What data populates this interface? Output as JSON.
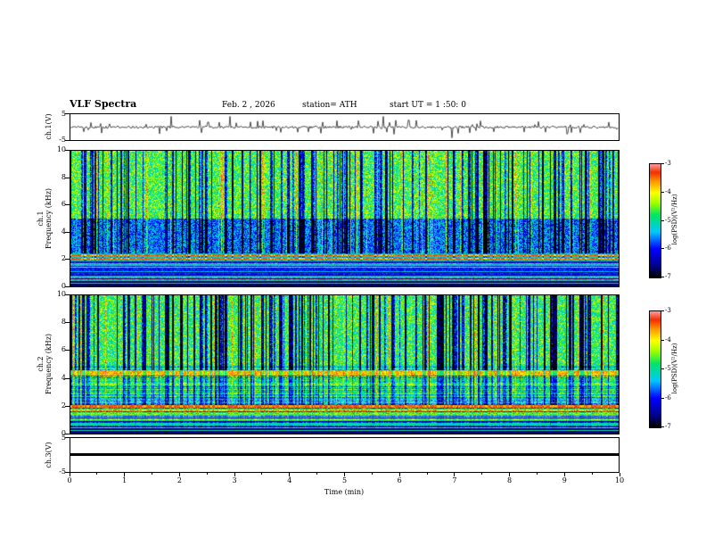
{
  "header": {
    "title": "VLF Spectra",
    "date": "Feb. 2 , 2026",
    "station": "station= ATH",
    "start_ut": "start UT =  1 :50: 0"
  },
  "x_axis": {
    "label": "Time (min)",
    "ticks": [
      "0",
      "1",
      "2",
      "3",
      "4",
      "5",
      "6",
      "7",
      "8",
      "9",
      "10"
    ]
  },
  "panels": {
    "wave1": {
      "ylabel": "ch.1(V)",
      "ytick_top": "5",
      "ytick_bottom": "-5"
    },
    "spec1": {
      "ylabel_line1": "ch.1",
      "ylabel_line2": "Frequency (kHz)",
      "yticks": [
        "10",
        "8",
        "6",
        "4",
        "2",
        "0"
      ]
    },
    "spec2": {
      "ylabel_line1": "ch.2",
      "ylabel_line2": "Frequency (kHz)",
      "yticks": [
        "10",
        "8",
        "6",
        "4",
        "2",
        "0"
      ]
    },
    "wave3": {
      "ylabel": "ch.3(V)",
      "ytick_top": "5",
      "ytick_bottom": "-5"
    }
  },
  "colorbar": {
    "label": "log(PSD)(V²/Hz)",
    "ticks": [
      "-3",
      "-4",
      "-5",
      "-6",
      "-7"
    ],
    "stops": [
      {
        "pos": 0.0,
        "color": "#000000"
      },
      {
        "pos": 0.1,
        "color": "#00008c"
      },
      {
        "pos": 0.25,
        "color": "#0000ff"
      },
      {
        "pos": 0.4,
        "color": "#00c8ff"
      },
      {
        "pos": 0.55,
        "color": "#00e664"
      },
      {
        "pos": 0.65,
        "color": "#96ff00"
      },
      {
        "pos": 0.75,
        "color": "#ffff00"
      },
      {
        "pos": 0.85,
        "color": "#ff9600"
      },
      {
        "pos": 0.93,
        "color": "#f03000"
      },
      {
        "pos": 1.0,
        "color": "#ff9696"
      }
    ]
  },
  "chart_data": [
    {
      "type": "line",
      "name": "ch1-waveform",
      "xlabel": "Time (min)",
      "xlim": [
        0,
        10
      ],
      "ylabel": "ch.1(V)",
      "ylim": [
        -5,
        5
      ],
      "summary": "Broadband VLF amplitude fluctuating around 0 V with frequent impulsive sferic spikes of roughly ±1 to ±4 V throughout the 10-minute record."
    },
    {
      "type": "heatmap",
      "name": "ch1-spectrogram",
      "xlabel": "Time (min)",
      "xlim": [
        0,
        10
      ],
      "ylabel": "ch.1 Frequency (kHz)",
      "ylim": [
        0,
        10
      ],
      "zlabel": "log(PSD)(V²/Hz)",
      "zlim": [
        -7,
        -3
      ],
      "summary": "Green/yellow broadband power above ~5 kHz with dense vertical sferic streaks; darker blue background 2.5–5 kHz; strong red/orange horizontal hum lines near 2 kHz; multiple colored horizontal lines below 2 kHz on a dark background; near-black band below ~0.4 kHz."
    },
    {
      "type": "heatmap",
      "name": "ch2-spectrogram",
      "xlabel": "Time (min)",
      "xlim": [
        0,
        10
      ],
      "ylabel": "ch.2 Frequency (kHz)",
      "ylim": [
        0,
        10
      ],
      "zlabel": "log(PSD)(V²/Hz)",
      "zlim": [
        -7,
        -3
      ],
      "summary": "Green background above ~5 kHz cut by many dark-blue vertical sferic streaks; red horizontal band near 4.3–4.6 kHz; mottled green/yellow horizontal banding 2–4 kHz; red hum line near 2 kHz; bright green/yellow horizontal lines below 2 kHz; near-black band below ~0.4 kHz."
    },
    {
      "type": "line",
      "name": "ch3-waveform",
      "xlabel": "Time (min)",
      "xlim": [
        0,
        10
      ],
      "ylabel": "ch.3(V)",
      "ylim": [
        -5,
        5
      ],
      "values_constant": 0,
      "summary": "Flat thick trace at ≈0 V for the whole interval."
    }
  ]
}
